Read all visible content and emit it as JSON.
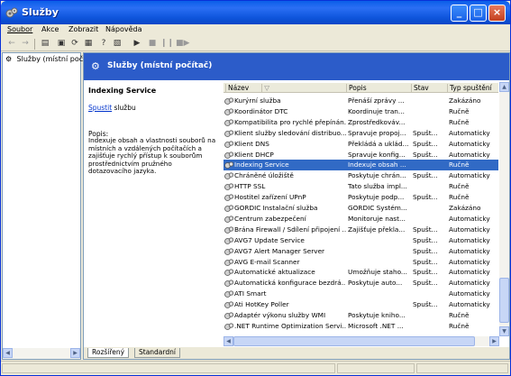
{
  "window": {
    "title": "Služby"
  },
  "menu": [
    "Soubor",
    "Akce",
    "Zobrazit",
    "Nápověda"
  ],
  "tree": {
    "root_label": "Služby (místní počíta"
  },
  "banner": {
    "title": "Služby (místní počítač)"
  },
  "description": {
    "service_name": "Indexing Service",
    "start_link": "Spustit",
    "start_suffix": "službu",
    "label": "Popis:",
    "text": "Indexuje obsah a vlastnosti souborů na místních a vzdálených počítačích a zajišťuje rychlý přístup k souborům prostřednictvím pružného dotazovacího jazyka."
  },
  "columns": [
    "Název",
    "Popis",
    "Stav",
    "Typ spuštění"
  ],
  "services": [
    {
      "name": "Kurýrní služba",
      "desc": "Přenáší zprávy ...",
      "state": "",
      "type": "Zakázáno"
    },
    {
      "name": "Koordinátor DTC",
      "desc": "Koordinuje tran...",
      "state": "",
      "type": "Ručně"
    },
    {
      "name": "Kompatibilita pro rychlé přepínán...",
      "desc": "Zprostředkováv...",
      "state": "",
      "type": "Ručně"
    },
    {
      "name": "Klient služby sledování distribuo...",
      "desc": "Spravuje propoj...",
      "state": "Spušt...",
      "type": "Automaticky"
    },
    {
      "name": "Klient DNS",
      "desc": "Překládá a uklád...",
      "state": "Spušt...",
      "type": "Automaticky"
    },
    {
      "name": "Klient DHCP",
      "desc": "Spravuje konfig...",
      "state": "Spušt...",
      "type": "Automaticky"
    },
    {
      "name": "Indexing Service",
      "desc": "Indexuje obsah ...",
      "state": "",
      "type": "Ručně"
    },
    {
      "name": "Chráněné úložiště",
      "desc": "Poskytuje chrán...",
      "state": "Spušt...",
      "type": "Automaticky"
    },
    {
      "name": "HTTP SSL",
      "desc": "Tato služba impl...",
      "state": "",
      "type": "Ručně"
    },
    {
      "name": "Hostitel zařízení UPnP",
      "desc": "Poskytuje podp...",
      "state": "Spušt...",
      "type": "Ručně"
    },
    {
      "name": "GORDIC Instalační služba",
      "desc": "GORDIC Systém...",
      "state": "",
      "type": "Zakázáno"
    },
    {
      "name": "Centrum zabezpečení",
      "desc": "Monitoruje nast...",
      "state": "",
      "type": "Automaticky"
    },
    {
      "name": "Brána Firewall / Sdílení připojení ...",
      "desc": "Zajišťuje překla...",
      "state": "Spušt...",
      "type": "Automaticky"
    },
    {
      "name": "AVG7 Update Service",
      "desc": "",
      "state": "Spušt...",
      "type": "Automaticky"
    },
    {
      "name": "AVG7 Alert Manager Server",
      "desc": "",
      "state": "Spušt...",
      "type": "Automaticky"
    },
    {
      "name": "AVG E-mail Scanner",
      "desc": "",
      "state": "Spušt...",
      "type": "Automaticky"
    },
    {
      "name": "Automatické aktualizace",
      "desc": "Umožňuje staho...",
      "state": "Spušt...",
      "type": "Automaticky"
    },
    {
      "name": "Automatická konfigurace bezdrá...",
      "desc": "Poskytuje auto...",
      "state": "Spušt...",
      "type": "Automaticky"
    },
    {
      "name": "ATI Smart",
      "desc": "",
      "state": "",
      "type": "Automaticky"
    },
    {
      "name": "Ati HotKey Poller",
      "desc": "",
      "state": "Spušt...",
      "type": "Automaticky"
    },
    {
      "name": "Adaptér výkonu služby WMI",
      "desc": "Poskytuje kniho...",
      "state": "",
      "type": "Ručně"
    },
    {
      "name": ".NET Runtime Optimization Servi...",
      "desc": "Microsoft .NET ...",
      "state": "",
      "type": "Ručně"
    }
  ],
  "selected_index": 6,
  "tabs": [
    "Rozšířený",
    "Standardní"
  ],
  "colors": {
    "title_blue": "#0a5ee8",
    "banner_blue": "#2c5cc9",
    "selection": "#316ac5"
  }
}
